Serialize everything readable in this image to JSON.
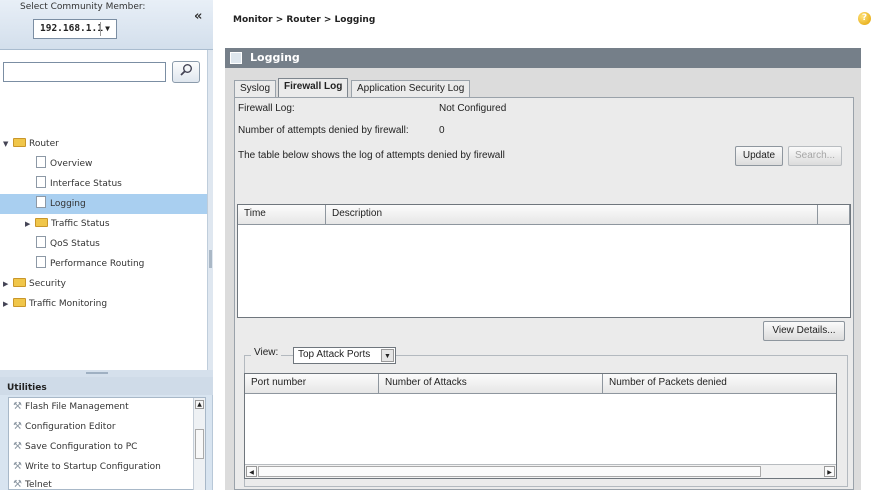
{
  "sidebar": {
    "member_label": "Select Community Member:",
    "member_value": "192.168.1.1",
    "collapse_glyph": "«",
    "search_placeholder": "",
    "tree": [
      {
        "label": "Router",
        "kind": "folder",
        "state": "expanded"
      },
      {
        "label": "Overview",
        "kind": "page"
      },
      {
        "label": "Interface Status",
        "kind": "page"
      },
      {
        "label": "Logging",
        "kind": "page",
        "selected": true
      },
      {
        "label": "Traffic Status",
        "kind": "folder",
        "state": "collapsed"
      },
      {
        "label": "QoS Status",
        "kind": "page"
      },
      {
        "label": "Performance Routing",
        "kind": "page"
      },
      {
        "label": "Security",
        "kind": "folder",
        "state": "collapsed"
      },
      {
        "label": "Traffic Monitoring",
        "kind": "folder",
        "state": "collapsed"
      }
    ],
    "utilities": {
      "title": "Utilities",
      "items": [
        "Flash File Management",
        "Configuration Editor",
        "Save Configuration to PC",
        "Write to Startup Configuration",
        "Telnet"
      ]
    }
  },
  "header": {
    "breadcrumb": "Monitor > Router > Logging",
    "help_glyph": "?"
  },
  "panel": {
    "title": "Logging",
    "tabs": [
      "Syslog",
      "Firewall Log",
      "Application Security Log"
    ],
    "active_tab": "Firewall Log",
    "firewall_log_label": "Firewall Log:",
    "firewall_log_value": "Not Configured",
    "attempts_label": "Number of attempts denied by firewall:",
    "attempts_value": "0",
    "table_note": "The table below shows the log of attempts denied by firewall",
    "update_button": "Update",
    "search_button": "Search...",
    "log_table": {
      "columns": [
        "Time",
        "Description"
      ],
      "rows": []
    },
    "view_details_button": "View Details...",
    "view_label": "View:",
    "view_value": "Top Attack Ports",
    "attack_table": {
      "columns": [
        "Port number",
        "Number of Attacks",
        "Number of Packets denied"
      ],
      "rows": []
    }
  },
  "colors": {
    "title_bar": "#757f89",
    "selected_tree_item": "#a9cff0",
    "sidebar_bg": "#d8e4f0",
    "folder": "#f0c64a"
  }
}
